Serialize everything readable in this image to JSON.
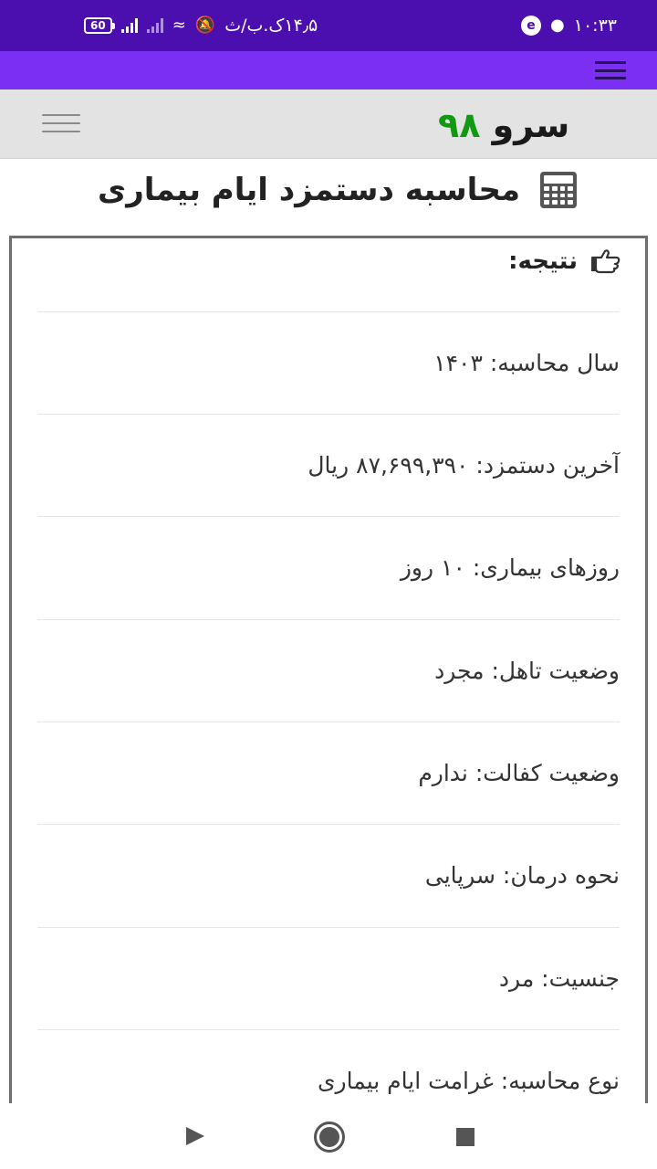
{
  "status_bar": {
    "time": "۱۰:۳۳",
    "network_speed": "۱۴٫۵ک.ب/ث",
    "battery": "60",
    "left_icons": [
      "signal-icon",
      "signal-icon",
      "wifi-icon",
      "mute-icon"
    ],
    "right_icons": [
      "app-notification-icon",
      "app-notification-icon"
    ]
  },
  "site": {
    "logo_word": "سرو",
    "logo_number": "۹۸",
    "colors": {
      "nav": "#7b2ff2",
      "status": "#4b0fb0",
      "logo_number": "#119a11"
    }
  },
  "page": {
    "title": "محاسبه دستمزد ایام بیماری"
  },
  "result": {
    "heading": "نتیجه:",
    "rows": [
      "سال محاسبه: ۱۴۰۳",
      "آخرین دستمزد: ۸۷,۶۹۹,۳۹۰ ریال",
      "روزهای بیماری: ۱۰ روز",
      "وضعیت تاهل: مجرد",
      "وضعیت کفالت: ندارم",
      "نحوه درمان: سرپایی",
      "جنسیت: مرد",
      "نوع محاسبه: غرامت ایام بیماری"
    ]
  },
  "nav_bar": {
    "buttons": [
      "back-icon",
      "home-icon",
      "recent-apps-icon"
    ]
  }
}
